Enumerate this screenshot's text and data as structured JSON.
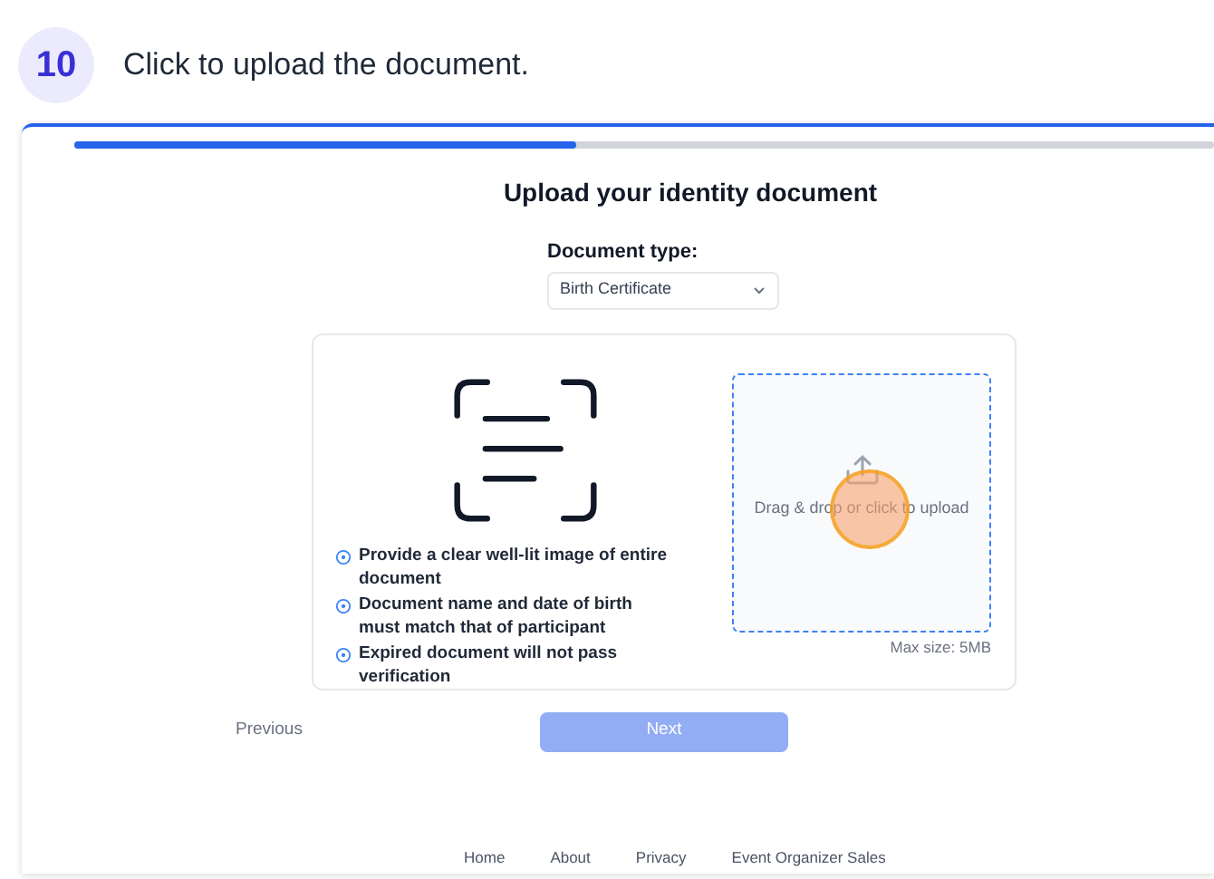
{
  "step": {
    "number": "10",
    "instruction": "Click to upload the document."
  },
  "progress": {
    "level": 0.44
  },
  "form": {
    "title": "Upload your identity document",
    "document_type": {
      "label": "Document type:",
      "value": "Birth Certificate"
    },
    "tips": [
      "Provide a clear well-lit image of entire document",
      "Document name and date of birth must match that of participant",
      "Expired document will not pass verification"
    ],
    "dropzone": {
      "text": "Drag & drop or click to upload",
      "max_size": "Max size: 5MB"
    }
  },
  "buttons": {
    "previous": "Previous",
    "next": {
      "label": "Next",
      "disabled": true
    }
  },
  "footer": [
    "Home",
    "About",
    "Privacy",
    "Event Organizer Sales"
  ]
}
